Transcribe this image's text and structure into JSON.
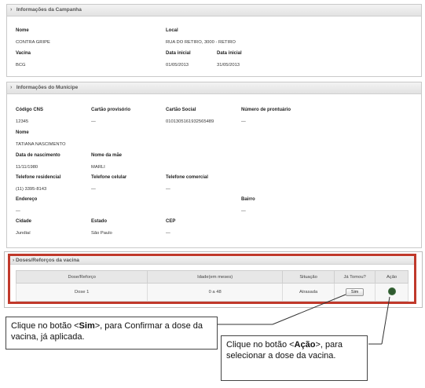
{
  "campanha": {
    "header": "Informações da Campanha",
    "nome_label": "Nome",
    "nome_value": "CONTRA GRIPE",
    "local_label": "Local",
    "local_value": "RUA DO RETIRO, 3000 - RETIRO",
    "vacina_label": "Vacina",
    "vacina_value": "BCG",
    "data_inicial_label": "Data inicial",
    "data_inicial_value": "01/05/2013",
    "data_final_label": "Data inicial",
    "data_final_value": "31/05/2013"
  },
  "municipe": {
    "header": "Informações do Munícipe",
    "cns_label": "Código CNS",
    "cns_value": "12345",
    "cartao_prov_label": "Cartão provisório",
    "cartao_prov_value": "—",
    "cartao_social_label": "Cartão Social",
    "cartao_social_value": "0101305161932565489",
    "prontuario_label": "Número de prontuário",
    "prontuario_value": "—",
    "nome_label": "Nome",
    "nome_value": "TATIANA NASCIMENTO",
    "nasc_label": "Data de nascimento",
    "nasc_value": "11/11/1980",
    "mae_label": "Nome da mãe",
    "mae_value": "MARLI",
    "tel_res_label": "Telefone residencial",
    "tel_res_value": "(11) 3395-8143",
    "tel_cel_label": "Telefone celular",
    "tel_cel_value": "—",
    "tel_com_label": "Telefone comercial",
    "tel_com_value": "—",
    "endereco_label": "Endereço",
    "endereco_value": "—",
    "bairro_label": "Bairro",
    "bairro_value": "—",
    "cidade_label": "Cidade",
    "cidade_value": "Jundiaí",
    "estado_label": "Estado",
    "estado_value": "São Paulo",
    "cep_label": "CEP",
    "cep_value": "—"
  },
  "doses": {
    "header": "Doses/Reforços da vacina",
    "columns": [
      "Dose/Reforço",
      "Idade(em meses)",
      "Situação",
      "Já Tomou?",
      "Ação"
    ],
    "row": {
      "dose": "Dose 1",
      "idade": "0 a 48",
      "situacao": "Atrasada",
      "sim_label": "Sim"
    }
  },
  "callouts": {
    "sim_prefix": "Clique no botão <",
    "sim_bold": "Sim",
    "sim_suffix": ">, para Confirmar a dose da vacina, já aplicada.",
    "acao_prefix": "Clique no botão <",
    "acao_bold": "Ação",
    "acao_suffix": ">, para selecionar a dose da vacina."
  },
  "colors": {
    "highlight_border": "#c0392b"
  }
}
